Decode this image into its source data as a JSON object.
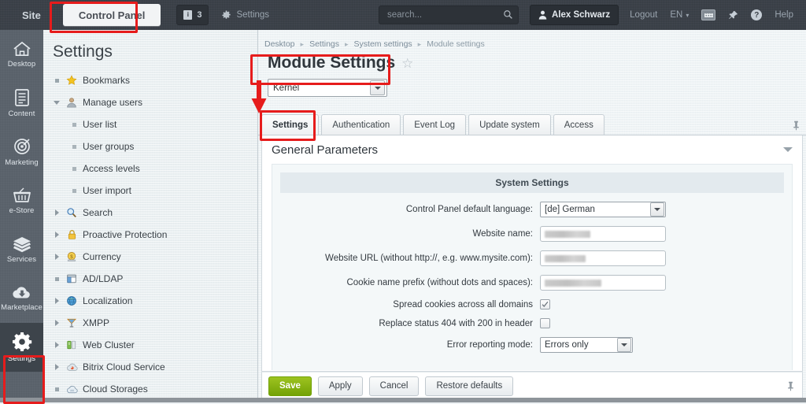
{
  "header": {
    "site_tab": "Site",
    "control_panel_tab": "Control Panel",
    "notification_count": "3",
    "settings_link": "Settings",
    "search_placeholder": "search...",
    "search_value": "",
    "user_name": "Alex Schwarz",
    "logout": "Logout",
    "language": "EN",
    "help": "Help"
  },
  "rail": {
    "items": [
      {
        "label": "Desktop",
        "icon": "home-icon",
        "active": false
      },
      {
        "label": "Content",
        "icon": "document-icon",
        "active": false
      },
      {
        "label": "Marketing",
        "icon": "target-icon",
        "active": false
      },
      {
        "label": "e-Store",
        "icon": "basket-icon",
        "active": false
      },
      {
        "label": "Services",
        "icon": "layers-icon",
        "active": false
      },
      {
        "label": "Marketplace",
        "icon": "cloud-download-icon",
        "active": false
      },
      {
        "label": "Settings",
        "icon": "gear-icon",
        "active": true
      }
    ]
  },
  "left_panel": {
    "title": "Settings",
    "tree": [
      {
        "label": "Bookmarks",
        "icon": "star-icon",
        "twisty": "dot",
        "level": 0
      },
      {
        "label": "Manage users",
        "icon": "user-icon",
        "twisty": "down",
        "level": 0
      },
      {
        "label": "User list",
        "icon": "none",
        "twisty": "dot",
        "level": 1
      },
      {
        "label": "User groups",
        "icon": "none",
        "twisty": "dot",
        "level": 1
      },
      {
        "label": "Access levels",
        "icon": "none",
        "twisty": "dot",
        "level": 1
      },
      {
        "label": "User import",
        "icon": "none",
        "twisty": "dot",
        "level": 1
      },
      {
        "label": "Search",
        "icon": "magnifier-icon",
        "twisty": "right",
        "level": 0
      },
      {
        "label": "Proactive Protection",
        "icon": "lock-icon",
        "twisty": "right",
        "level": 0
      },
      {
        "label": "Currency",
        "icon": "coin-icon",
        "twisty": "right",
        "level": 0
      },
      {
        "label": "AD/LDAP",
        "icon": "directory-icon",
        "twisty": "dot",
        "level": 0
      },
      {
        "label": "Localization",
        "icon": "globe-icon",
        "twisty": "right",
        "level": 0
      },
      {
        "label": "XMPP",
        "icon": "xmpp-icon",
        "twisty": "right",
        "level": 0
      },
      {
        "label": "Web Cluster",
        "icon": "cluster-icon",
        "twisty": "right",
        "level": 0
      },
      {
        "label": "Bitrix Cloud Service",
        "icon": "cloud-fire-icon",
        "twisty": "right",
        "level": 0
      },
      {
        "label": "Cloud Storages",
        "icon": "cloud-storage-icon",
        "twisty": "dot",
        "level": 0
      }
    ]
  },
  "main": {
    "breadcrumbs": [
      "Desktop",
      "Settings",
      "System settings",
      "Module settings"
    ],
    "page_title": "Module Settings",
    "module_select_value": "Kernel",
    "tabs": [
      {
        "label": "Settings",
        "active": true
      },
      {
        "label": "Authentication",
        "active": false
      },
      {
        "label": "Event Log",
        "active": false
      },
      {
        "label": "Update system",
        "active": false
      },
      {
        "label": "Access",
        "active": false
      }
    ],
    "panel_title": "General Parameters",
    "section_title": "System Settings",
    "fields": [
      {
        "label": "Control Panel default language:",
        "type": "select",
        "value": "[de] German"
      },
      {
        "label": "Website name:",
        "type": "text",
        "value": "",
        "redacted_width": 58
      },
      {
        "label": "Website URL (without http://, e.g. www.mysite.com):",
        "type": "text",
        "value": "",
        "redacted_width": 52
      },
      {
        "label": "Cookie name prefix (without dots and spaces):",
        "type": "text",
        "value": "",
        "redacted_width": 72
      },
      {
        "label": "Spread cookies across all domains",
        "type": "checkbox",
        "checked": true
      },
      {
        "label": "Replace status 404 with 200 in header",
        "type": "checkbox",
        "checked": false
      },
      {
        "label": "Error reporting mode:",
        "type": "select-small",
        "value": "Errors only"
      }
    ],
    "buttons": [
      {
        "label": "Save",
        "primary": true
      },
      {
        "label": "Apply",
        "primary": false
      },
      {
        "label": "Cancel",
        "primary": false
      },
      {
        "label": "Restore defaults",
        "primary": false
      }
    ]
  },
  "annotations": {
    "accent_color": "#e61c1c",
    "boxes": [
      "control-panel-tab",
      "module-settings-title",
      "settings-tab",
      "settings-rail-item"
    ],
    "arrow": "points from Module Settings title down to Settings tab"
  },
  "colors": {
    "topbar": "#3b4149",
    "rail": "#5b636c",
    "rail_active": "#3d444b",
    "left_panel": "#e9eff1",
    "main_bg": "#eef3f5",
    "panel_bg": "#ffffff",
    "save_green": "#8ab408",
    "annotation_red": "#e61c1c"
  }
}
